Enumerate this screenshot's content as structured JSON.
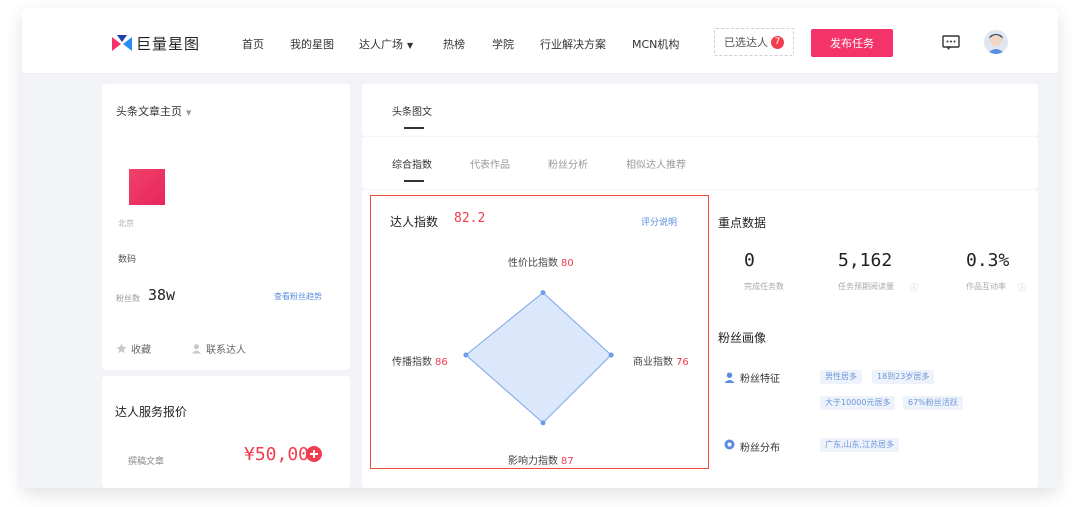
{
  "nav": {
    "logo_text": "巨量星图",
    "items": [
      "首页",
      "我的星图",
      "达人广场",
      "热榜",
      "学院",
      "行业解决方案",
      "MCN机构"
    ],
    "dropdown_caret": "▼",
    "applied_label": "已选达人",
    "applied_count": "7",
    "publish_label": "发布任务",
    "colors": {
      "accent": "#f5336b",
      "badge": "#f23d4f"
    }
  },
  "profile": {
    "title": "头条文章主页",
    "title_caret": "▼",
    "location": "北京",
    "tag": "数码",
    "fans_label": "粉丝数",
    "fans_value": "38w",
    "trend_link": "查看粉丝趋势",
    "actions": {
      "favorite": "收藏",
      "contact": "联系达人"
    }
  },
  "pricing": {
    "title": "达人服务报价",
    "item_label": "撰稿文章",
    "item_price": "¥50,000"
  },
  "tabs": {
    "top": [
      "头条图文"
    ],
    "sub": [
      "综合指数",
      "代表作品",
      "粉丝分析",
      "相似达人推荐"
    ]
  },
  "index_card": {
    "title": "达人指数",
    "score": "82.2",
    "help_link": "评分说明",
    "dimensions": [
      {
        "name": "性价比指数",
        "value": 80
      },
      {
        "name": "商业指数",
        "value": 76
      },
      {
        "name": "影响力指数",
        "value": 87
      },
      {
        "name": "传播指数",
        "value": 86
      }
    ]
  },
  "key_data": {
    "title": "重点数据",
    "metrics": [
      {
        "value": "0",
        "label": "完成任务数"
      },
      {
        "value": "5,162",
        "label": "任务预期阅读量"
      },
      {
        "value": "0.3%",
        "label": "作品互动率"
      }
    ]
  },
  "fan_profile": {
    "title": "粉丝画像",
    "feature_label": "粉丝特征",
    "feature_chips_row1": [
      "男性居多",
      "18到23岁居多"
    ],
    "feature_chips_row2": [
      "大于10000元居多",
      "67%粉丝活跃"
    ],
    "distribution_label": "粉丝分布",
    "distribution_chips": [
      "广东,山东,江苏居多"
    ]
  },
  "chart_data": {
    "type": "radar",
    "axes": [
      "性价比指数",
      "商业指数",
      "影响力指数",
      "传播指数"
    ],
    "values": [
      80,
      76,
      87,
      86
    ],
    "overall": 82.2
  }
}
